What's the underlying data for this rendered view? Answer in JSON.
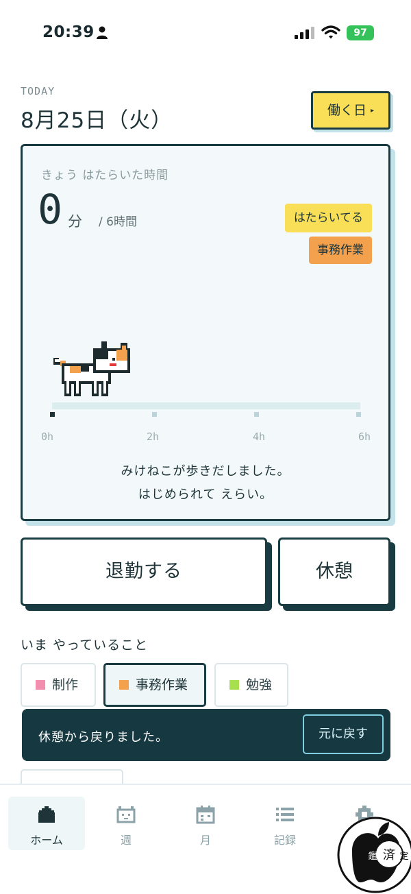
{
  "status_bar": {
    "time": "20:39",
    "battery": "97"
  },
  "header": {
    "today_label": "TODAY",
    "date": "8月25日（火）",
    "workday_button": "働く日"
  },
  "card": {
    "worked_label": "きょう はたらいた時間",
    "minutes_value": "0",
    "minutes_unit": "分",
    "goal": "/ 6時間",
    "status_badge": "はたらいてる",
    "task_badge": "事務作業",
    "progress_fraction": 0.0,
    "tick_labels": [
      "0h",
      "2h",
      "4h",
      "6h"
    ],
    "message_line1": "みけねこが歩きだしました。",
    "message_line2": "はじめられて えらい。"
  },
  "actions": {
    "leave": "退勤する",
    "break": "休憩"
  },
  "activity": {
    "heading": "いま やっていること",
    "chips": [
      {
        "label": "制作",
        "color": "#f28fae"
      },
      {
        "label": "事務作業",
        "color": "#f3a14d"
      },
      {
        "label": "勉強",
        "color": "#a8df4f"
      }
    ]
  },
  "toast": {
    "message": "休憩から戻りました。",
    "undo": "元に戻す"
  },
  "tabs": [
    {
      "label": "ホーム",
      "icon": "home-icon"
    },
    {
      "label": "週",
      "icon": "cat-face-icon"
    },
    {
      "label": "月",
      "icon": "calendar-icon"
    },
    {
      "label": "記録",
      "icon": "list-icon"
    },
    {
      "label": "設定",
      "icon": "gear-icon"
    }
  ],
  "colors": {
    "accent_yellow": "#f8df57",
    "accent_orange": "#f3a14d",
    "dark": "#183c42"
  }
}
